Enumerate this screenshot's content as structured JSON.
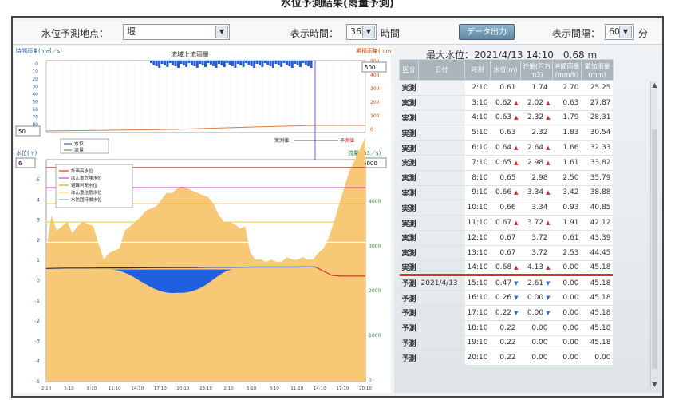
{
  "page": {
    "heading": "水位予測結果(雨量予測)"
  },
  "controls": {
    "station_label": "水位予測地点：",
    "station_value": "堰",
    "display_time_label": "表示時間：",
    "display_time_value": "36",
    "display_time_unit": "時間",
    "export_button": "データ出力",
    "interval_label": "表示間隔：",
    "interval_value": "60",
    "interval_unit": "分"
  },
  "rain_chart": {
    "title": "流域上流雨量",
    "left_axis_label": "時間雨量(m㎥／s)",
    "right_axis_label": "累積雨量(mm)",
    "left_ticks": [
      "0",
      "10",
      "20",
      "30",
      "40",
      "50",
      "60",
      "70",
      "80",
      "90"
    ],
    "right_ticks": [
      "0",
      "100",
      "200",
      "300",
      "400",
      "500"
    ],
    "right_select_value": "500",
    "left_select_value": "50",
    "legend": [
      "水位",
      "流量"
    ],
    "actual_label": "実測値",
    "forecast_label": "予測値"
  },
  "level_chart": {
    "left_axis_label": "水位(m)",
    "right_axis_label": "流量(m3／s)",
    "left_select_value": "6",
    "right_select_value": "5000",
    "left_ticks": [
      "-5",
      "-4",
      "-3",
      "-2",
      "-1",
      "0",
      "1",
      "2",
      "3",
      "4",
      "5"
    ],
    "right_ticks": [
      "0",
      "1000",
      "2000",
      "3000",
      "4000"
    ],
    "legend": [
      "計画高水位",
      "はん濫危険水位",
      "避難判断水位",
      "はん濫注意水位",
      "水防団待機水位"
    ],
    "x_ticks": [
      "2:10",
      "5:10",
      "8:10",
      "11:10",
      "14:10",
      "17:10",
      "20:10",
      "23:10",
      "2:10",
      "5:10",
      "8:10",
      "11:10",
      "14:10",
      "17:10",
      "20:10"
    ]
  },
  "chart_data": {
    "type": "area",
    "x_label": "",
    "threshold_lines": [
      {
        "name": "計画高水位",
        "value": 5.6,
        "color": "#e03030"
      },
      {
        "name": "はん濫危険水位",
        "value": 4.6,
        "color": "#d23ad2"
      },
      {
        "name": "避難判断水位",
        "value": 3.8,
        "color": "#e8a028"
      },
      {
        "name": "はん濫注意水位",
        "value": 2.9,
        "color": "#f0d060"
      },
      {
        "name": "水防団待機水位",
        "value": 1.9,
        "color": "#ffffff"
      }
    ],
    "flow_profile": [
      0.4,
      0.25,
      0.32,
      0.3,
      0.28,
      0.33,
      0.3,
      0.28,
      0.29,
      0.3,
      0.38,
      0.45,
      0.42,
      0.41,
      0.4,
      0.32,
      0.3,
      0.28,
      0.26,
      0.23,
      0.22,
      0.21,
      0.18,
      0.15,
      0.15,
      0.13,
      0.12,
      0.13,
      0.14,
      0.15,
      0.16,
      0.17,
      0.2,
      0.25,
      0.28,
      0.28,
      0.29,
      0.31,
      0.3,
      0.42,
      0.45,
      0.45,
      0.46,
      0.45,
      0.46,
      0.46,
      0.44,
      0.45,
      0.45,
      0.44,
      0.45,
      0.45,
      0.42,
      0.4,
      0.35,
      0.28,
      0.2,
      0.12,
      0.05,
      0.0,
      -0.05,
      -0.1
    ],
    "water_level_actual": [
      0.6,
      0.62,
      0.62,
      0.63,
      0.63,
      0.64,
      0.65,
      0.65,
      0.66,
      0.66,
      0.67,
      0.67,
      0.67,
      0.68
    ],
    "water_level_forecast": [
      0.47,
      0.26,
      0.22,
      0.22,
      0.22,
      0.22
    ],
    "depression_min": -0.6
  },
  "table": {
    "max_level_label": "最大水位：2021/4/13 14:10　0.68 m",
    "headers": [
      "区分",
      "日付",
      "時刻",
      "水位(m)",
      "貯量(百万m3)",
      "時間雨量(mm/h)",
      "累加雨量(mm)"
    ],
    "rows": [
      {
        "kind": "実測",
        "date": "",
        "time": "2:10",
        "level": "0.61",
        "ld": "",
        "storage": "1.74",
        "sd": "",
        "rain": "2.70",
        "cum": "25.25"
      },
      {
        "kind": "実測",
        "date": "",
        "time": "3:10",
        "level": "0.62",
        "ld": "▲",
        "storage": "2.02",
        "sd": "▲",
        "rain": "0.63",
        "cum": "27.87"
      },
      {
        "kind": "実測",
        "date": "",
        "time": "4:10",
        "level": "0.63",
        "ld": "▲",
        "storage": "2.32",
        "sd": "▲",
        "rain": "1.79",
        "cum": "28.31"
      },
      {
        "kind": "実測",
        "date": "",
        "time": "5:10",
        "level": "0.63",
        "ld": "",
        "storage": "2.32",
        "sd": "",
        "rain": "1.83",
        "cum": "30.54"
      },
      {
        "kind": "実測",
        "date": "",
        "time": "6:10",
        "level": "0.64",
        "ld": "▲",
        "storage": "2.64",
        "sd": "▲",
        "rain": "1.66",
        "cum": "32.33"
      },
      {
        "kind": "実測",
        "date": "",
        "time": "7:10",
        "level": "0.65",
        "ld": "▲",
        "storage": "2.98",
        "sd": "▲",
        "rain": "1.61",
        "cum": "33.82"
      },
      {
        "kind": "実測",
        "date": "",
        "time": "8:10",
        "level": "0.65",
        "ld": "",
        "storage": "2.98",
        "sd": "",
        "rain": "2.50",
        "cum": "35.79"
      },
      {
        "kind": "実測",
        "date": "",
        "time": "9:10",
        "level": "0.66",
        "ld": "▲",
        "storage": "3.34",
        "sd": "▲",
        "rain": "3.42",
        "cum": "38.88"
      },
      {
        "kind": "実測",
        "date": "",
        "time": "10:10",
        "level": "0.66",
        "ld": "",
        "storage": "3.34",
        "sd": "",
        "rain": "0.93",
        "cum": "40.85"
      },
      {
        "kind": "実測",
        "date": "",
        "time": "11:10",
        "level": "0.67",
        "ld": "▲",
        "storage": "3.72",
        "sd": "▲",
        "rain": "1.91",
        "cum": "42.12"
      },
      {
        "kind": "実測",
        "date": "",
        "time": "12:10",
        "level": "0.67",
        "ld": "",
        "storage": "3.72",
        "sd": "",
        "rain": "0.61",
        "cum": "43.39"
      },
      {
        "kind": "実測",
        "date": "",
        "time": "13:10",
        "level": "0.67",
        "ld": "",
        "storage": "3.72",
        "sd": "",
        "rain": "2.53",
        "cum": "44.45"
      },
      {
        "kind": "実測",
        "date": "",
        "time": "14:10",
        "level": "0.68",
        "ld": "▲",
        "storage": "4.13",
        "sd": "▲",
        "rain": "0.00",
        "cum": "45.18"
      },
      {
        "kind": "予測",
        "date": "2021/4/13",
        "time": "15:10",
        "level": "0.47",
        "ld": "▼",
        "storage": "2.61",
        "sd": "▼",
        "rain": "0.00",
        "cum": "45.18"
      },
      {
        "kind": "予測",
        "date": "",
        "time": "16:10",
        "level": "0.26",
        "ld": "▼",
        "storage": "0.00",
        "sd": "▼",
        "rain": "0.00",
        "cum": "45.18"
      },
      {
        "kind": "予測",
        "date": "",
        "time": "17:10",
        "level": "0.22",
        "ld": "▼",
        "storage": "0.00",
        "sd": "▼",
        "rain": "0.00",
        "cum": "45.18"
      },
      {
        "kind": "予測",
        "date": "",
        "time": "18:10",
        "level": "0.22",
        "ld": "",
        "storage": "0.00",
        "sd": "",
        "rain": "0.00",
        "cum": "45.18"
      },
      {
        "kind": "予測",
        "date": "",
        "time": "19:10",
        "level": "0.22",
        "ld": "",
        "storage": "0.00",
        "sd": "",
        "rain": "0.00",
        "cum": "45.18"
      },
      {
        "kind": "予測",
        "date": "",
        "time": "20:10",
        "level": "0.22",
        "ld": "",
        "storage": "0.00",
        "sd": "",
        "rain": "0.00",
        "cum": "0.00"
      }
    ]
  }
}
